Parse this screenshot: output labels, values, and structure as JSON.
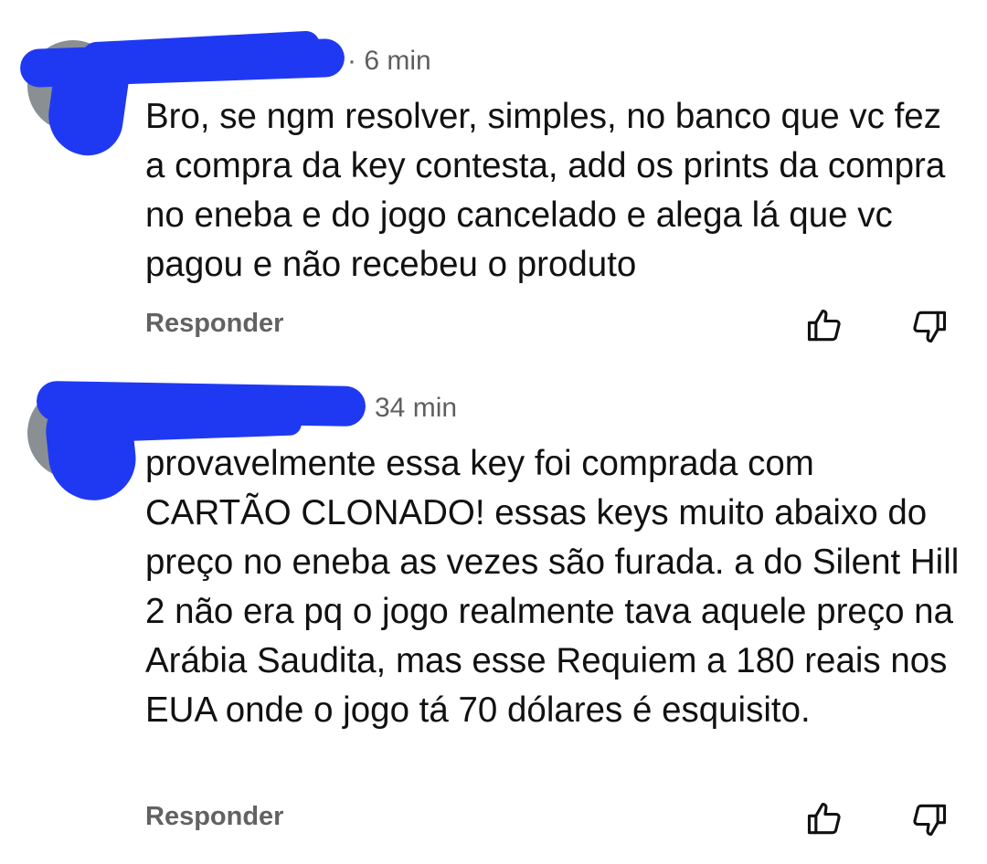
{
  "comments": [
    {
      "time": "· 6 min",
      "text": "Bro, se ngm resolver, simples, no banco que vc fez a compra da key contesta, add os prints da compra no eneba e do jogo cancelado e alega lá que vc pagou e não recebeu o produto",
      "reply_label": "Responder",
      "like_icon": "thumbs-up-icon",
      "dislike_icon": "thumbs-down-icon"
    },
    {
      "time": "34 min",
      "text": "provavelmente essa key foi comprada com CARTÃO CLONADO! essas keys muito abaixo do preço no eneba as vezes são furada. a do Silent Hill 2 não era pq o jogo realmente tava aquele preço na Arábia Saudita, mas esse Requiem a 180 reais nos EUA onde o jogo tá 70 dólares é esquisito.",
      "reply_label": "Responder",
      "like_icon": "thumbs-up-icon",
      "dislike_icon": "thumbs-down-icon"
    }
  ],
  "colors": {
    "redaction": "#1f39f2",
    "text": "#111111",
    "meta": "#5f5f5f",
    "reply": "#626262"
  }
}
